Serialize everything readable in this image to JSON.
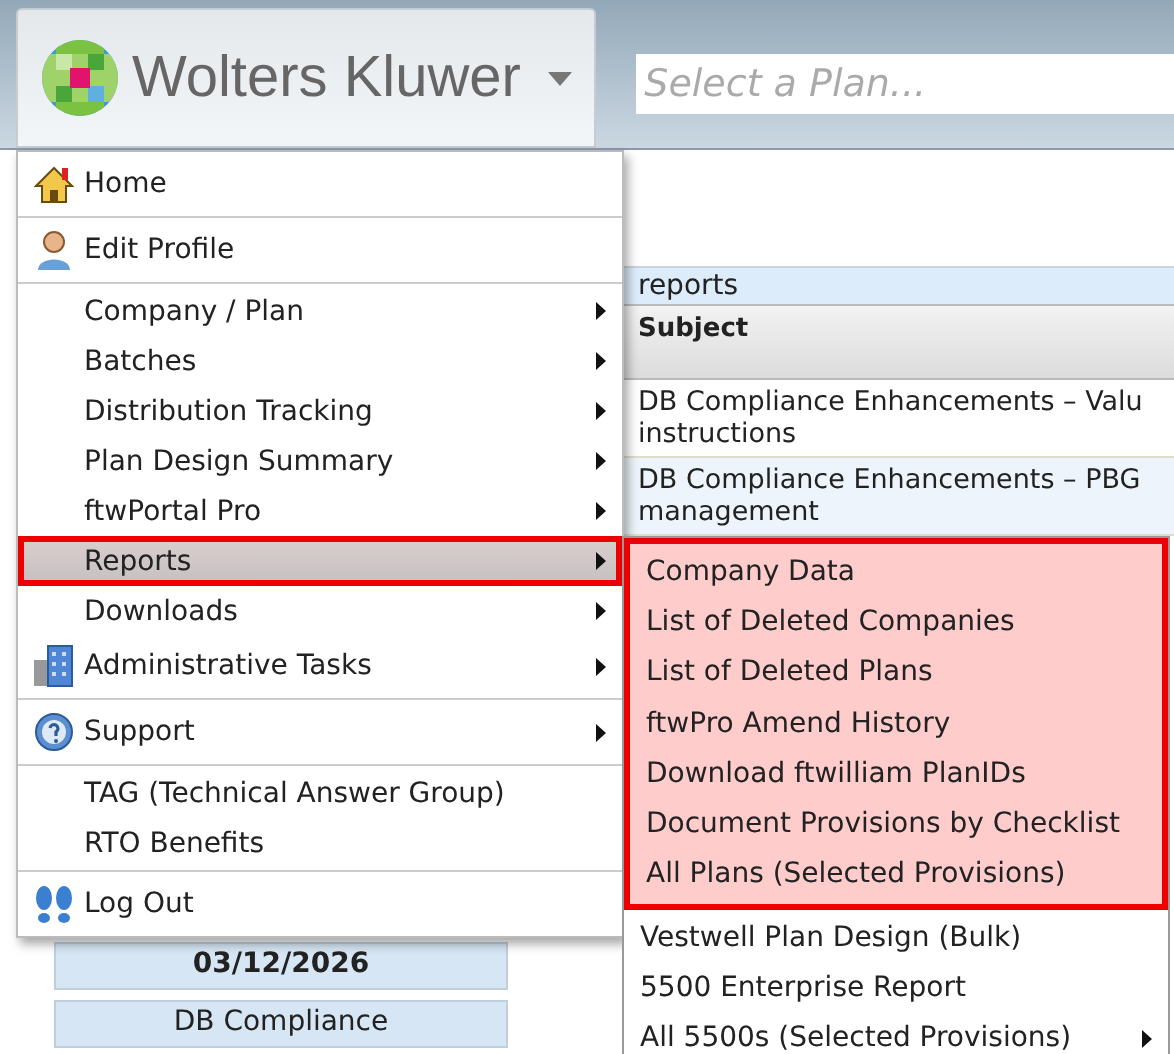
{
  "header": {
    "logo_text": "Wolters Kluwer",
    "plan_search": {
      "placeholder": "Select a Plan..."
    }
  },
  "background_panel": {
    "title": "reports",
    "column": "Subject",
    "rows": [
      {
        "lines": [
          "DB Compliance Enhancements – Valu",
          "instructions"
        ]
      },
      {
        "lines": [
          "DB Compliance Enhancements – PBG",
          "management"
        ]
      }
    ]
  },
  "background_cards": [
    {
      "text": "03/12/2026",
      "kind": "date"
    },
    {
      "text": "DB Compliance",
      "kind": "title"
    }
  ],
  "menu": {
    "sections": [
      {
        "items": [
          {
            "label": "Home",
            "kind": "home",
            "has_submenu": false,
            "selected": false,
            "highlighted": false
          }
        ]
      },
      {
        "items": [
          {
            "label": "Edit Profile",
            "kind": "person",
            "has_submenu": false,
            "selected": false,
            "highlighted": false
          }
        ]
      },
      {
        "items": [
          {
            "label": "Company / Plan",
            "kind": "plain",
            "has_submenu": true,
            "selected": false,
            "highlighted": false
          },
          {
            "label": "Batches",
            "kind": "plain",
            "has_submenu": true,
            "selected": false,
            "highlighted": false
          },
          {
            "label": "Distribution Tracking",
            "kind": "plain",
            "has_submenu": true,
            "selected": false,
            "highlighted": false
          },
          {
            "label": "Plan Design Summary",
            "kind": "plain",
            "has_submenu": true,
            "selected": false,
            "highlighted": false
          },
          {
            "label": "ftwPortal Pro",
            "kind": "plain",
            "has_submenu": true,
            "selected": false,
            "highlighted": false
          },
          {
            "label": "Reports",
            "kind": "plain",
            "has_submenu": true,
            "selected": true,
            "highlighted": true
          },
          {
            "label": "Downloads",
            "kind": "plain",
            "has_submenu": true,
            "selected": false,
            "highlighted": false
          },
          {
            "label": "Administrative Tasks",
            "kind": "building",
            "has_submenu": true,
            "selected": false,
            "highlighted": false
          }
        ]
      },
      {
        "items": [
          {
            "label": "Support",
            "kind": "help",
            "has_submenu": true,
            "selected": false,
            "highlighted": false
          }
        ]
      },
      {
        "items": [
          {
            "label": "TAG (Technical Answer Group)",
            "kind": "plain",
            "has_submenu": false,
            "selected": false,
            "highlighted": false
          },
          {
            "label": "RTO Benefits",
            "kind": "plain",
            "has_submenu": false,
            "selected": false,
            "highlighted": false
          }
        ]
      },
      {
        "items": [
          {
            "label": "Log Out",
            "kind": "footprints",
            "has_submenu": false,
            "selected": false,
            "highlighted": false
          }
        ]
      }
    ]
  },
  "submenu": {
    "groups": [
      {
        "highlighted": true,
        "items": [
          {
            "label": "Company Data",
            "has_submenu": false
          },
          {
            "label": "List of Deleted Companies",
            "has_submenu": false
          },
          {
            "label": "List of Deleted Plans",
            "has_submenu": false
          },
          {
            "label": "ftwPro Amend History",
            "has_submenu": false
          },
          {
            "label": "Download ftwilliam PlanIDs",
            "has_submenu": false
          },
          {
            "label": "Document Provisions by Checklist",
            "has_submenu": false
          },
          {
            "label": "All Plans (Selected Provisions)",
            "has_submenu": false
          }
        ]
      },
      {
        "highlighted": false,
        "items": [
          {
            "label": "Vestwell Plan Design (Bulk)",
            "has_submenu": false
          },
          {
            "label": "5500 Enterprise Report",
            "has_submenu": false
          },
          {
            "label": "All 5500s (Selected Provisions)",
            "has_submenu": true
          }
        ]
      }
    ]
  }
}
